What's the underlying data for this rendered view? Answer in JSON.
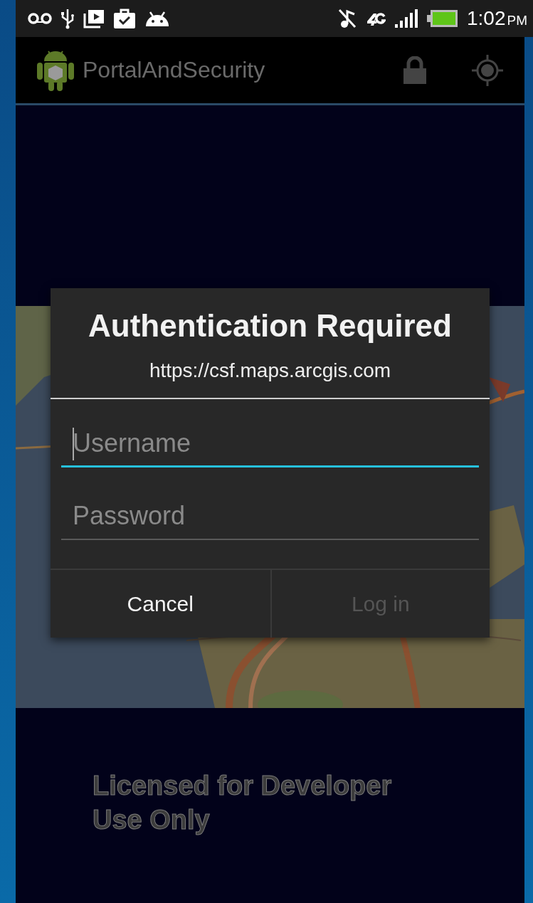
{
  "status_bar": {
    "time": "1:02",
    "period": "PM"
  },
  "action_bar": {
    "title": "PortalAndSecurity"
  },
  "map": {
    "kind": "picture",
    "license_text": "Licensed for Developer Use Only"
  },
  "dialog": {
    "title": "Authentication Required",
    "subtitle": "https://csf.maps.arcgis.com",
    "fields": [
      {
        "placeholder": "Username",
        "focused": true
      },
      {
        "placeholder": "Password",
        "focused": false
      }
    ],
    "buttons": [
      {
        "label": "Cancel",
        "disabled": false
      },
      {
        "label": "Log in",
        "disabled": true
      }
    ]
  }
}
